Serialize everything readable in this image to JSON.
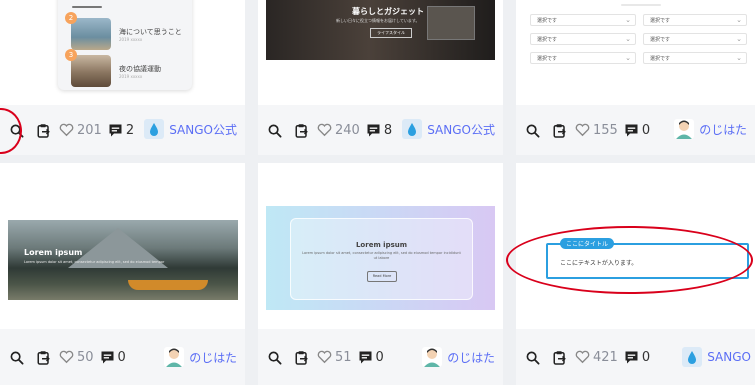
{
  "cards": [
    {
      "preview": {
        "items": [
          {
            "number": "2",
            "title": "海について思うこと",
            "meta": "2019 xxxxx"
          },
          {
            "number": "3",
            "title": "夜の協議運動",
            "meta": "2019 xxxxx"
          }
        ]
      },
      "likes": "201",
      "comments": "2",
      "author": "SANGO公式",
      "avatar": "sango-logo"
    },
    {
      "preview": {
        "title": "暮らしとガジェット",
        "subtitle": "新しい日々に役立つ情報をお届けしています。",
        "button": "ライフスタイル"
      },
      "likes": "240",
      "comments": "8",
      "author": "SANGO公式",
      "avatar": "sango-logo"
    },
    {
      "preview": {
        "selects": [
          "選択です",
          "選択です",
          "選択です",
          "選択です",
          "選択です",
          "選択です"
        ]
      },
      "likes": "155",
      "comments": "0",
      "author": "のじはた",
      "avatar": "person-avatar"
    },
    {
      "preview": {
        "title": "Lorem ipsum",
        "text": "Lorem ipsum dolor sit amet, consectetur adipiscing elit, sed do eiusmod tempor"
      },
      "likes": "50",
      "comments": "0",
      "author": "のじはた",
      "avatar": "person-avatar"
    },
    {
      "preview": {
        "title": "Lorem ipsum",
        "text": "Lorem ipsum dolor sit amet, consectetur adipiscing elit, sed do eiusmod tempor incididunt ut labore",
        "button": "Read More"
      },
      "likes": "51",
      "comments": "0",
      "author": "のじはた",
      "avatar": "person-avatar"
    },
    {
      "preview": {
        "label": "ここにタイトル",
        "text": "ここにテキストが入ります。"
      },
      "likes": "421",
      "comments": "0",
      "author": "SANGO",
      "avatar": "sango-logo"
    }
  ],
  "colors": {
    "accent": "#5b6ef5",
    "highlight": "#d9001b",
    "boxLabel": "#2b9fe0"
  },
  "icons": [
    "search-icon",
    "copy-icon",
    "heart-icon",
    "comment-icon"
  ]
}
